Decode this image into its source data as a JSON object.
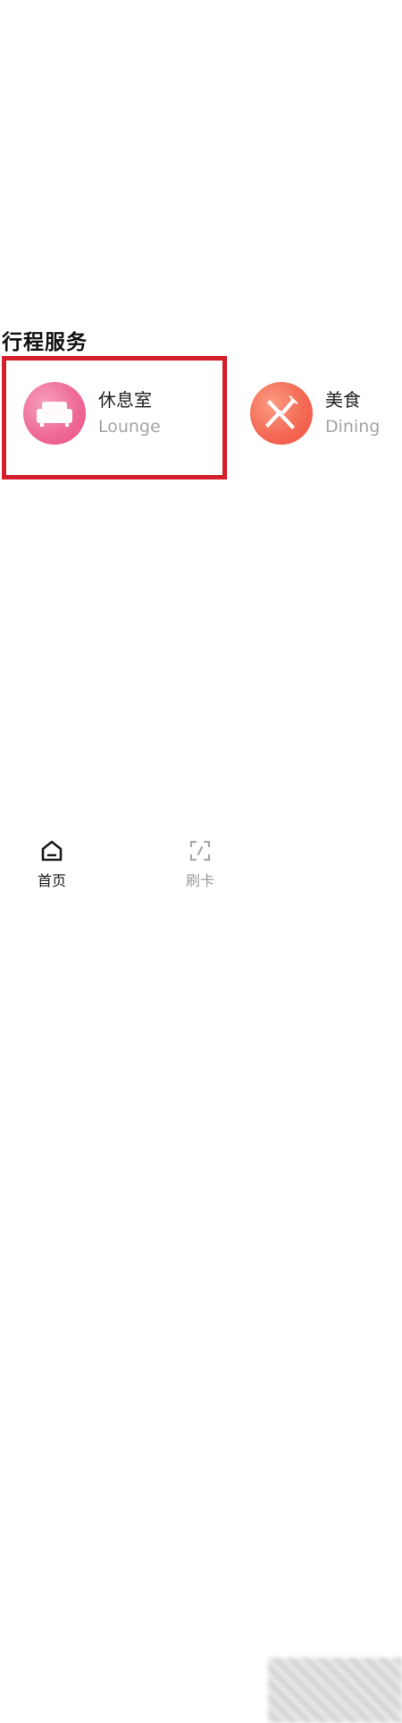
{
  "section": {
    "title": "行程服务"
  },
  "services": [
    {
      "name": "休息室",
      "subtitle": "Lounge",
      "icon": "sofa-icon",
      "color": "#ef6b96"
    },
    {
      "name": "美食",
      "subtitle": "Dining",
      "icon": "fork-knife-icon",
      "color": "#f46a55"
    }
  ],
  "highlight": {
    "color": "#d3202c"
  },
  "bottom_nav": {
    "items": [
      {
        "label": "首页",
        "icon": "home-icon",
        "active": true
      },
      {
        "label": "刷卡",
        "icon": "card-swipe-icon",
        "active": false
      }
    ]
  }
}
